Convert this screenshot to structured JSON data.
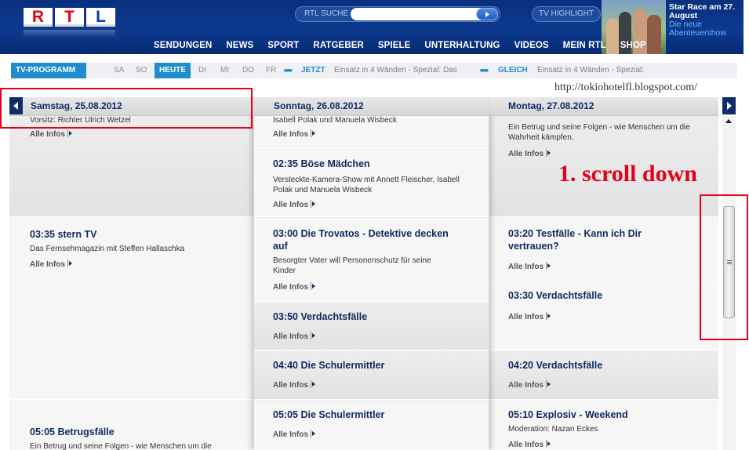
{
  "header": {
    "logo_letters": [
      "R",
      "T",
      "L"
    ],
    "search_label": "RTL SUCHE",
    "search_value": "",
    "tv_highlight": "TV HIGHLIGHT",
    "promo_title": "Star Race am 27. August",
    "promo_sub": "Die neue Abenteuershow",
    "nav": [
      "SENDUNGEN",
      "NEWS",
      "SPORT",
      "RATGEBER",
      "SPIELE",
      "UNTERHALTUNG",
      "VIDEOS",
      "MEIN RTL",
      "SHOP"
    ]
  },
  "subbar": {
    "label": "TV-PROGRAMM",
    "days": [
      "SA",
      "SO",
      "HEUTE",
      "DI",
      "MI",
      "DO",
      "FR"
    ],
    "jetzt_label": "JETZT",
    "jetzt_text": "Einsatz in 4 Wänden - Spezial: Das",
    "gleich_label": "GLEICH",
    "gleich_text": "Einsatz in 4 Wänden - Spezial:"
  },
  "watermark": "http://tokiohotelfl.blogspot.com/",
  "more_label": "Alle Infos",
  "columns": [
    {
      "date": "Samstag, 25.08.2012",
      "top_partial": "Vorsitz: Richter Ulrich Wetzel",
      "shows": [
        {
          "time_title": "03:35 stern TV",
          "desc": "Das Fernsehmagazin mit Steffen Hallaschka"
        },
        {
          "time_title": "05:05 Betrugsfälle",
          "desc": "Ein Betrug und seine Folgen - wie Menschen um die Wahrheit kämpfen."
        }
      ]
    },
    {
      "date": "Sonntag, 26.08.2012",
      "top_partial": "Isabell Polak und Manuela Wisbeck",
      "shows": [
        {
          "time_title": "02:35 Böse Mädchen",
          "desc": "Versteckte-Kamera-Show mit Annett Fleischer, Isabell Polak und Manuela Wisbeck"
        },
        {
          "time_title": "03:00 Die Trovatos - Detektive decken auf",
          "desc": "Besorgter Vater will Personenschutz für seine Kinder"
        },
        {
          "time_title": "03:50 Verdachtsfälle",
          "desc": ""
        },
        {
          "time_title": "04:40 Die Schulermittler",
          "desc": ""
        },
        {
          "time_title": "05:05 Die Schulermittler",
          "desc": ""
        }
      ]
    },
    {
      "date": "Montag, 27.08.2012",
      "top_partial": "Ein Betrug und seine Folgen - wie Menschen um die Wahrheit kämpfen.",
      "shows": [
        {
          "time_title": "03:20 Testfälle - Kann ich Dir vertrauen?",
          "desc": ""
        },
        {
          "time_title": "03:30 Verdachtsfälle",
          "desc": ""
        },
        {
          "time_title": "04:20 Verdachtsfälle",
          "desc": ""
        },
        {
          "time_title": "05:10 Explosiv - Weekend",
          "desc": "Moderation: Nazan Eckes"
        }
      ]
    }
  ],
  "annotation": {
    "text": "1. scroll down",
    "color": "#e3001b"
  }
}
